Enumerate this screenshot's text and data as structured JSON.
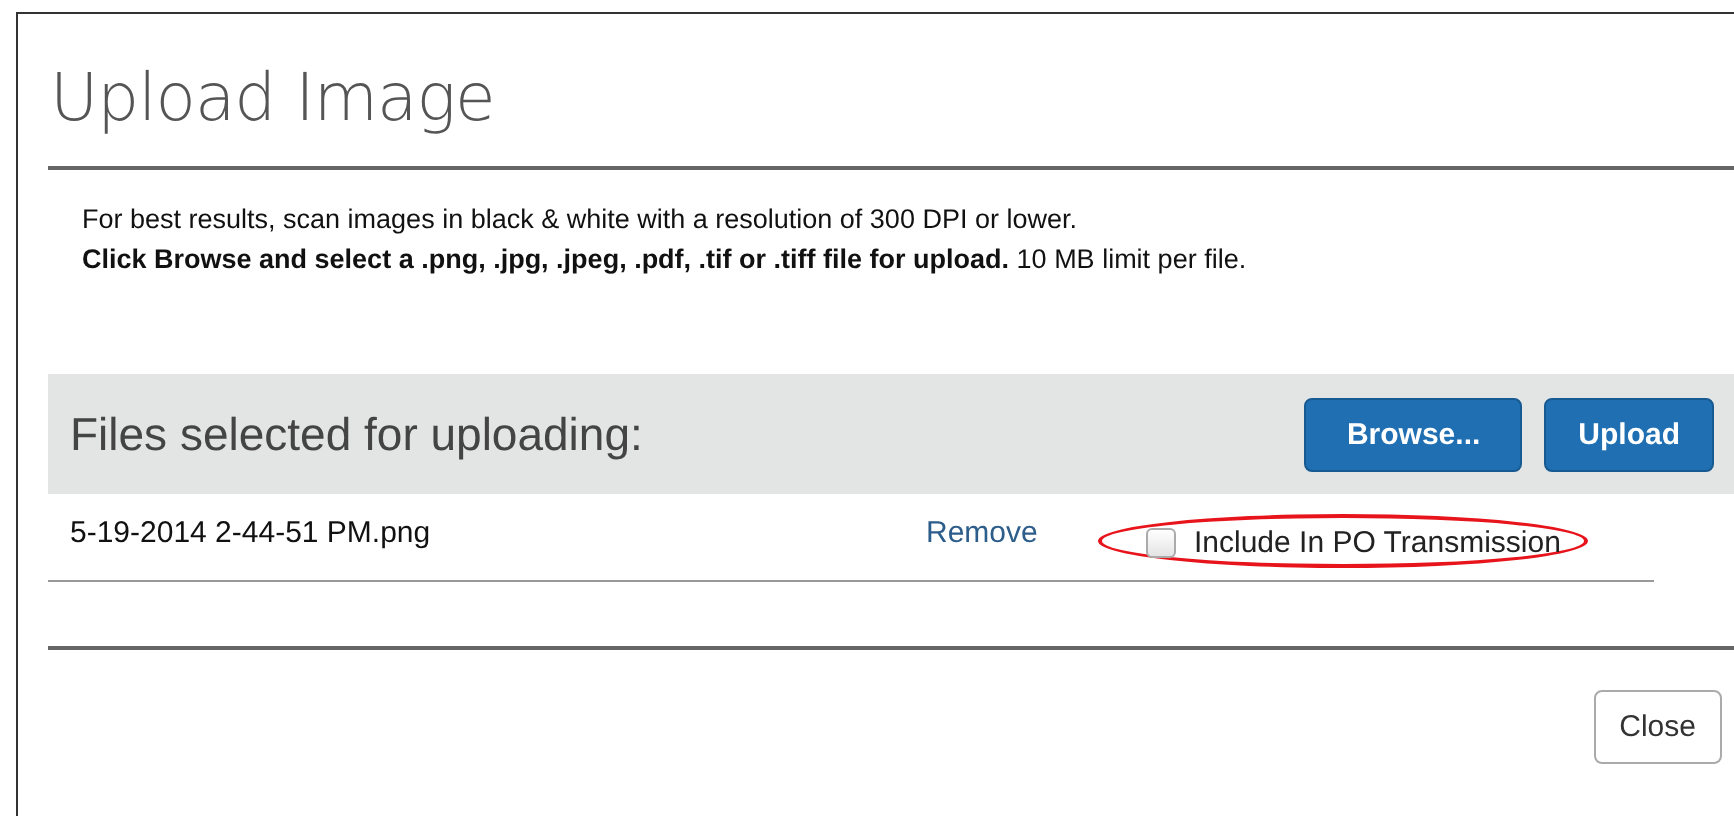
{
  "dialog": {
    "title": "Upload Image",
    "instructions": [
      "For best results, scan images in black & white with a resolution of 300 DPI or lower.",
      "**Click Browse and select a .png, .jpg, .jpeg, .pdf, .tif or .tiff file for upload.** 10 MB limit per file."
    ],
    "files_header": {
      "label": "Files selected for uploading:",
      "buttons": [
        "Browse...",
        "Upload"
      ]
    },
    "files": [
      {
        "name": "5-19-2014 2-44-51 PM.png",
        "remove": "Remove",
        "option": {
          "label": "Include In PO Transmission",
          "checked": false,
          "highlighted": true
        }
      }
    ],
    "footer_buttons": [
      "Close"
    ]
  }
}
